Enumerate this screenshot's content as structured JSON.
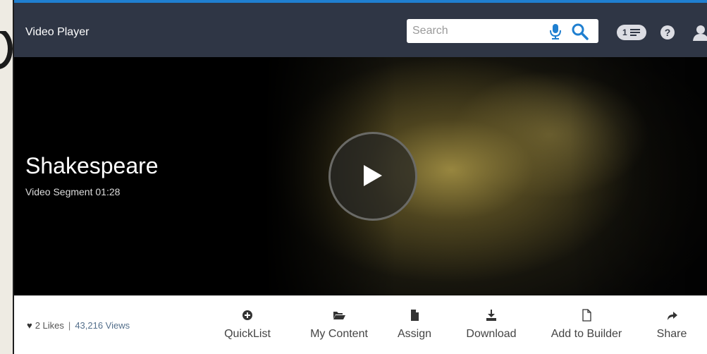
{
  "header": {
    "title": "Video Player",
    "search_placeholder": "Search",
    "quicklist_count": "1",
    "help_symbol": "?"
  },
  "video": {
    "title": "Shakespeare",
    "meta": "Video Segment  01:28"
  },
  "stats": {
    "likes": "2 Likes",
    "separator": "|",
    "views": "43,216 Views"
  },
  "actions": [
    {
      "label": "QuickList",
      "icon": "plus-circle-icon"
    },
    {
      "label": "My Content",
      "icon": "folder-open-icon"
    },
    {
      "label": "Assign",
      "icon": "document-icon"
    },
    {
      "label": "Download",
      "icon": "download-icon"
    },
    {
      "label": "Add to Builder",
      "icon": "file-outline-icon"
    },
    {
      "label": "Share",
      "icon": "share-arrow-icon"
    }
  ],
  "colors": {
    "topbar": "#2f3645",
    "accent": "#1f7fd0",
    "search_icon": "#1f7fd0"
  }
}
